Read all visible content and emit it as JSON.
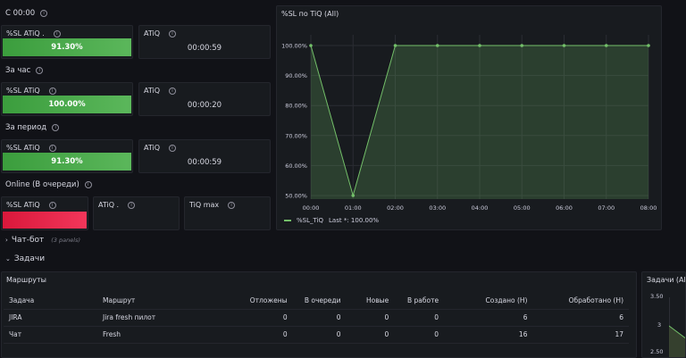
{
  "sections": {
    "since_midnight": "С 00:00",
    "last_hour": "За час",
    "period": "За период",
    "online": "Online (В очереди)"
  },
  "stats": {
    "midnight_sl_title": "%SL ATiQ .",
    "midnight_sl_value": "91.30%",
    "midnight_atiq_title": "ATiQ",
    "midnight_atiq_value": "00:00:59",
    "hour_sl_title": "%SL ATiQ",
    "hour_sl_value": "100.00%",
    "hour_atiq_title": "ATiQ",
    "hour_atiq_value": "00:00:20",
    "period_sl_title": "%SL ATiQ",
    "period_sl_value": "91.30%",
    "period_atiq_title": "ATiQ",
    "period_atiq_value": "00:00:59",
    "online_sl_title": "%SL ATiQ",
    "online_atiq_title": "ATiQ .",
    "online_tiq_max_title": "TiQ max"
  },
  "chart_panel": {
    "title": "%SL по TiQ (All)",
    "legend_label": "%SL_TiQ",
    "legend_last": "Last *: 100.00%"
  },
  "chart_data": {
    "type": "area",
    "title": "%SL по TiQ (All)",
    "x": [
      "00:00",
      "01:00",
      "02:00",
      "03:00",
      "04:00",
      "05:00",
      "06:00",
      "07:00",
      "08:00"
    ],
    "series": [
      {
        "name": "%SL_TiQ",
        "values": [
          100,
          50,
          100,
          100,
          100,
          100,
          100,
          100,
          100
        ]
      }
    ],
    "y_ticks": [
      "50.00%",
      "60.00%",
      "70.00%",
      "80.00%",
      "90.00%",
      "100.00%"
    ],
    "ylim": [
      50,
      100
    ],
    "grid": true,
    "legend": "bottom-left",
    "color": "#73bf69"
  },
  "rows": {
    "chatbot": "Чат-бот",
    "chatbot_sub": "(3 panels)",
    "tasks": "Задачи"
  },
  "routes_panel": {
    "title": "Маршруты",
    "columns": [
      "Задача",
      "Маршрут",
      "Отложены",
      "В очереди",
      "Новые",
      "В работе",
      "Создано (Н)",
      "Обработано (Н)"
    ],
    "rows": [
      [
        "JIRA",
        "Jira fresh пилот",
        "0",
        "0",
        "0",
        "0",
        "6",
        "6"
      ],
      [
        "Чат",
        "Fresh",
        "0",
        "0",
        "0",
        "0",
        "16",
        "17"
      ]
    ]
  },
  "tasks_panel": {
    "title": "Задачи (All)",
    "y_ticks": [
      "3.50",
      "3",
      "2.50"
    ]
  }
}
